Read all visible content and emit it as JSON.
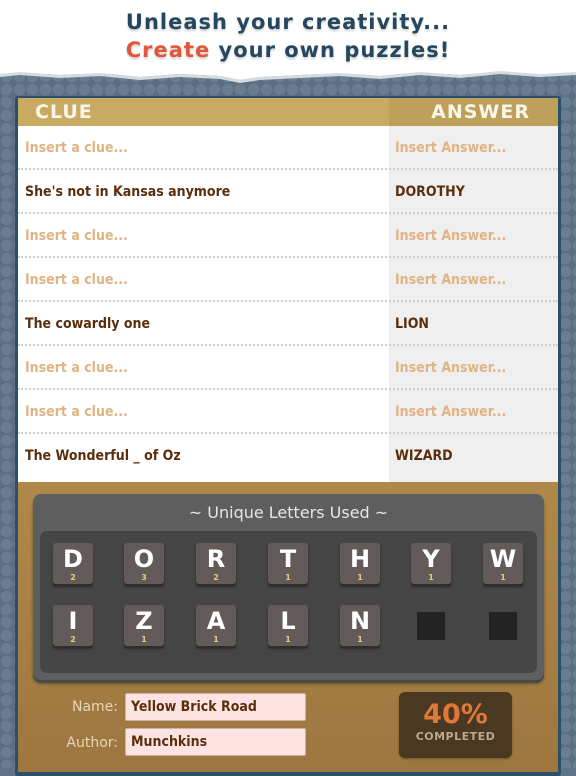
{
  "banner": {
    "line1": "Unleash your creativity...",
    "line2_accent": "Create",
    "line2_rest": " your own puzzles!"
  },
  "colors": {
    "title": "#24475d",
    "accent": "#e4553a",
    "header_gold": "#c8aa62",
    "filled_text": "#5a2e0c",
    "placeholder_text": "#dfb384",
    "progress_text": "#e0783a"
  },
  "table": {
    "headers": {
      "clue": "CLUE",
      "answer": "ANSWER"
    },
    "rows": [
      {
        "clue": "",
        "answer": "",
        "clue_placeholder": "Insert a clue...",
        "answer_placeholder": "Insert Answer..."
      },
      {
        "clue": "She's not in Kansas anymore",
        "answer": "DOROTHY",
        "clue_placeholder": "Insert a clue...",
        "answer_placeholder": "Insert Answer..."
      },
      {
        "clue": "",
        "answer": "",
        "clue_placeholder": "Insert a clue...",
        "answer_placeholder": "Insert Answer..."
      },
      {
        "clue": "",
        "answer": "",
        "clue_placeholder": "Insert a clue...",
        "answer_placeholder": "Insert Answer..."
      },
      {
        "clue": "The cowardly one",
        "answer": "LION",
        "clue_placeholder": "Insert a clue...",
        "answer_placeholder": "Insert Answer..."
      },
      {
        "clue": "",
        "answer": "",
        "clue_placeholder": "Insert a clue...",
        "answer_placeholder": "Insert Answer..."
      },
      {
        "clue": "",
        "answer": "",
        "clue_placeholder": "Insert a clue...",
        "answer_placeholder": "Insert Answer..."
      },
      {
        "clue": "The Wonderful _ of Oz",
        "answer": "WIZARD",
        "clue_placeholder": "Insert a clue...",
        "answer_placeholder": "Insert Answer..."
      }
    ]
  },
  "letters": {
    "title": "~ Unique Letters Used ~",
    "tiles": [
      {
        "letter": "D",
        "count": "2"
      },
      {
        "letter": "O",
        "count": "3"
      },
      {
        "letter": "R",
        "count": "2"
      },
      {
        "letter": "T",
        "count": "1"
      },
      {
        "letter": "H",
        "count": "1"
      },
      {
        "letter": "Y",
        "count": "1"
      },
      {
        "letter": "W",
        "count": "1"
      },
      {
        "letter": "I",
        "count": "2"
      },
      {
        "letter": "Z",
        "count": "1"
      },
      {
        "letter": "A",
        "count": "1"
      },
      {
        "letter": "L",
        "count": "1"
      },
      {
        "letter": "N",
        "count": "1"
      }
    ],
    "empty_slots": 2
  },
  "footer": {
    "name_label": "Name:",
    "name_value": "Yellow Brick Road",
    "author_label": "Author:",
    "author_value": "Munchkins",
    "progress_value": "40%",
    "progress_label": "COMPLETED"
  }
}
